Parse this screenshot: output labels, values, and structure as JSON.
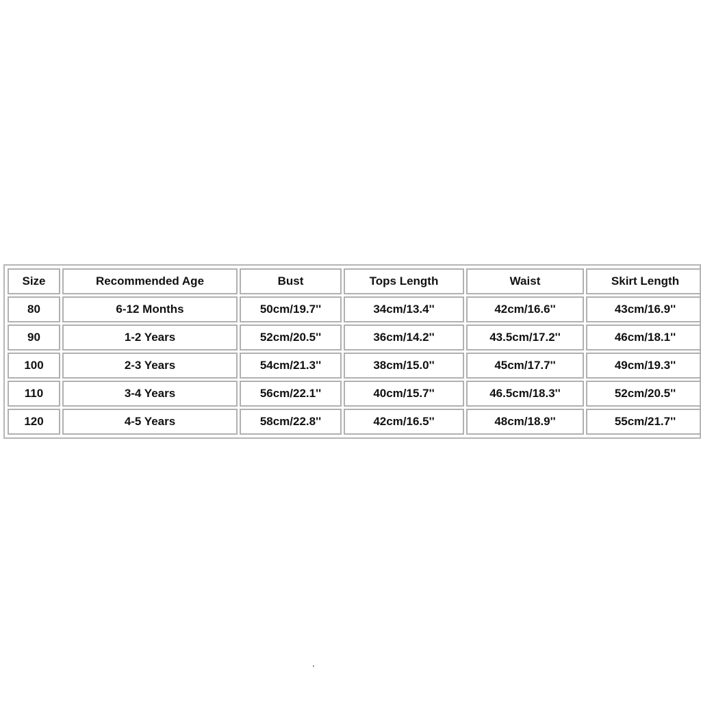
{
  "table": {
    "headers": [
      "Size",
      "Recommended Age",
      "Bust",
      "Tops Length",
      "Waist",
      "Skirt Length"
    ],
    "rows": [
      [
        "80",
        "6-12 Months",
        "50cm/19.7''",
        "34cm/13.4''",
        "42cm/16.6''",
        "43cm/16.9''"
      ],
      [
        "90",
        "1-2 Years",
        "52cm/20.5''",
        "36cm/14.2''",
        "43.5cm/17.2''",
        "46cm/18.1''"
      ],
      [
        "100",
        "2-3 Years",
        "54cm/21.3''",
        "38cm/15.0''",
        "45cm/17.7''",
        "49cm/19.3''"
      ],
      [
        "110",
        "3-4 Years",
        "56cm/22.1''",
        "40cm/15.7''",
        "46.5cm/18.3''",
        "52cm/20.5''"
      ],
      [
        "120",
        "4-5 Years",
        "58cm/22.8''",
        "42cm/16.5''",
        "48cm/18.9''",
        "55cm/21.7''"
      ]
    ]
  }
}
